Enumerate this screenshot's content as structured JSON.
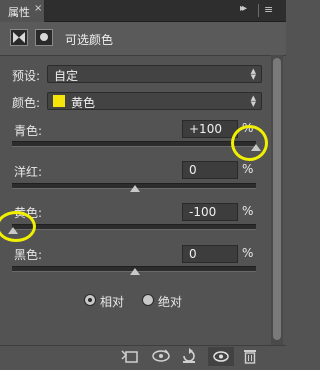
{
  "panel": {
    "tab_label": "属性",
    "close_glyph": "×",
    "collapse_glyph": "▸▸",
    "menu_glyph": "≡",
    "title": "可选颜色",
    "adjustment_icon": "selective-color-icon",
    "mask_icon": "mask-icon"
  },
  "preset": {
    "label": "预设:",
    "value": "自定"
  },
  "colors": {
    "label": "颜色:",
    "value": "黄色",
    "swatch_color": "#f5e50a"
  },
  "sliders": [
    {
      "label": "青色:",
      "value": "+100",
      "unit": "%",
      "position": 1.0
    },
    {
      "label": "洋红:",
      "value": "0",
      "unit": "%",
      "position": 0.5
    },
    {
      "label": "黄色:",
      "value": "-100",
      "unit": "%",
      "position": 0.0
    },
    {
      "label": "黑色:",
      "value": "0",
      "unit": "%",
      "position": 0.5
    }
  ],
  "method": {
    "relative_label": "相对",
    "absolute_label": "绝对",
    "selected": "relative"
  },
  "bottom_icons": [
    "clip-to-layer-icon",
    "view-previous-icon",
    "reset-icon",
    "visibility-eye-icon",
    "trash-icon"
  ],
  "highlight_color": "#f0f000"
}
